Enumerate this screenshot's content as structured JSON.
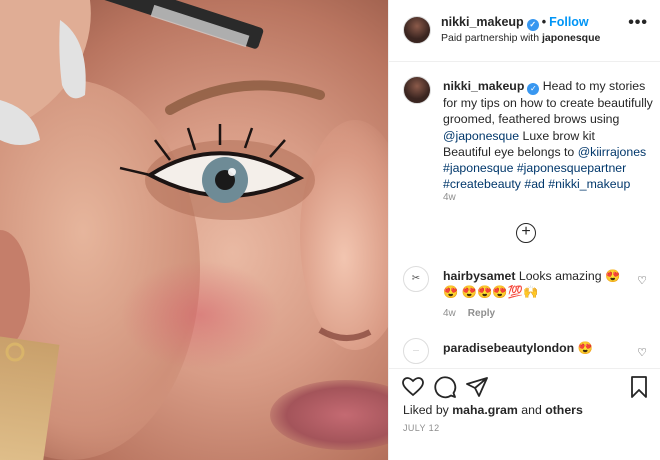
{
  "post": {
    "author": "nikki_makeup",
    "follow_label": "Follow",
    "dot": "•",
    "partnership_prefix": "Paid partnership with ",
    "partner": "japonesque",
    "more": "•••"
  },
  "caption": {
    "author": "nikki_makeup",
    "text_1": " Head to my stories for my tips on how to create beautifully groomed, feathered brows using ",
    "mention_1": "@japonesque",
    "text_2": " Luxe brow kit",
    "text_3": "Beautiful eye belongs to ",
    "mention_2": "@kiirrajones",
    "hashtags": "#japonesque #japonesquepartner #createbeauty #ad #nikki_makeup",
    "time": "4w"
  },
  "load_more": "+",
  "comments": [
    {
      "user": "hairbysamet",
      "text": " Looks amazing 😍😍 😍😍😍💯🙌",
      "time": "4w",
      "reply": "Reply"
    },
    {
      "user": "paradisebeautylondon",
      "text": " 😍"
    }
  ],
  "likes": {
    "prefix": "Liked by ",
    "user": "maha.gram",
    "middle": " and ",
    "others": "others"
  },
  "date": "JULY 12"
}
